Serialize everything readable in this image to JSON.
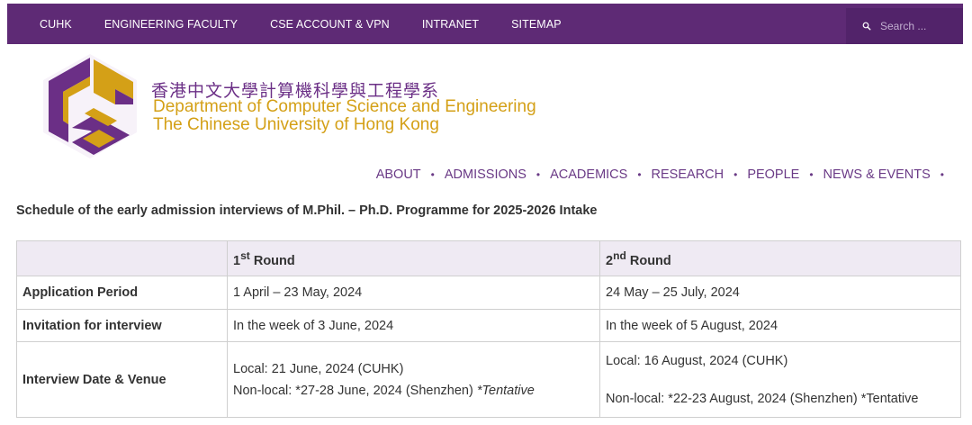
{
  "topnav": {
    "items": [
      "CUHK",
      "ENGINEERING FACULTY",
      "CSE ACCOUNT & VPN",
      "INTRANET",
      "SITEMAP"
    ],
    "search_placeholder": "Search ..."
  },
  "header": {
    "chinese_name": "香港中文大學計算機科學與工程學系",
    "department": "Department of Computer Science and Engineering",
    "university": "The Chinese University of Hong Kong"
  },
  "mainnav": {
    "items": [
      "ABOUT",
      "ADMISSIONS",
      "ACADEMICS",
      "RESEARCH",
      "PEOPLE",
      "NEWS & EVENTS"
    ]
  },
  "page": {
    "heading": "Schedule of the early admission interviews of M.Phil. – Ph.D. Programme for 2025-2026 Intake"
  },
  "table": {
    "headers": {
      "round1_num": "1",
      "round1_sup": "st",
      "round1_word": " Round",
      "round2_num": "2",
      "round2_sup": "nd",
      "round2_word": " Round"
    },
    "rows": [
      {
        "label": "Application Period",
        "r1": "1 April – 23 May, 2024",
        "r2": "24 May – 25 July, 2024"
      },
      {
        "label": "Invitation for interview",
        "r1": "In the week of 3 June, 2024",
        "r2": "In the week of 5 August, 2024"
      },
      {
        "label": "Interview Date & Venue",
        "r1_local": "Local: 21 June, 2024 (CUHK)",
        "r1_nonlocal": "Non-local: *27-28 June, 2024 (Shenzhen) ",
        "r1_tentative": "*Tentative",
        "r2_local": "Local: 16 August, 2024 (CUHK)",
        "r2_nonlocal": "Non-local: *22-23 August, 2024 (Shenzhen) *Tentative"
      }
    ]
  },
  "colors": {
    "topbar": "#5e2a75",
    "brand_purple": "#6b2f86",
    "brand_gold": "#d4a017"
  },
  "icons": {
    "search": "search-icon",
    "logo": "cse-logo"
  }
}
